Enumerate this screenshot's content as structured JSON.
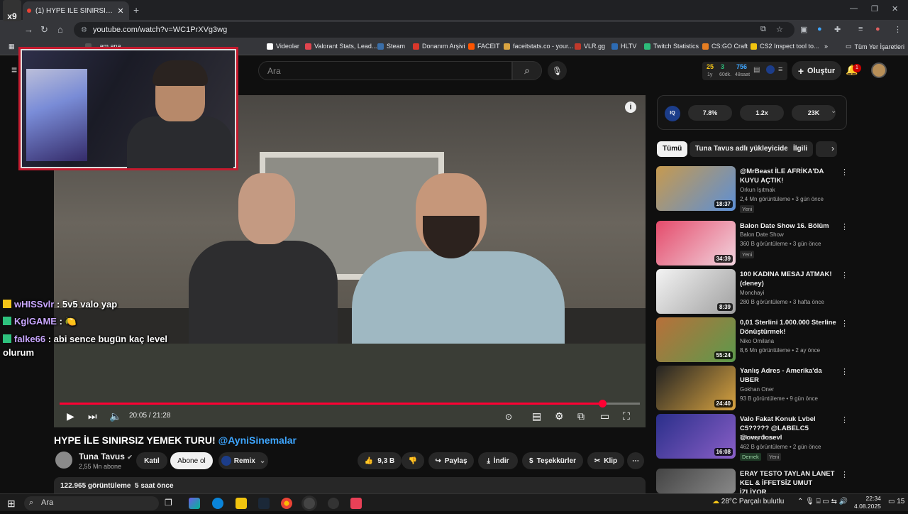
{
  "browser": {
    "tab_title": "(1) HYPE İLE SINIRSIZ YEMEK TU",
    "tab_close": "✕",
    "newtab": "+",
    "url": "youtube.com/watch?v=WC1PrXVg3wg",
    "bookmarks": [
      {
        "label": "...am ana...",
        "color": "#555555"
      },
      {
        "label": "Videolar",
        "color": "#ffffff"
      },
      {
        "label": "Valorant Stats, Lead...",
        "color": "#e0444e"
      },
      {
        "label": "Steam",
        "color": "#3a6ea8"
      },
      {
        "label": "Donanım Arşivi",
        "color": "#d9372b"
      },
      {
        "label": "FACEIT",
        "color": "#ff5500"
      },
      {
        "label": "faceitstats.co - your...",
        "color": "#d9a441"
      },
      {
        "label": "VLR.gg",
        "color": "#c0392b"
      },
      {
        "label": "HLTV",
        "color": "#2d6bb3"
      },
      {
        "label": "Twitch Statistics",
        "color": "#2dbb7a"
      },
      {
        "label": "CS:GO Craft",
        "color": "#e67e22"
      },
      {
        "label": "CS2 Inspect tool to...",
        "color": "#f1c40f"
      }
    ],
    "bookmarks_more": "»",
    "all_bookmarks": "Tüm Yer İşaretleri"
  },
  "youtube": {
    "search_placeholder": "Ara",
    "ext_stats": {
      "a": "25",
      "a_label": "1y",
      "b": "3",
      "b_label": "60dk.",
      "c": "756",
      "c_label": "48saat"
    },
    "create_label": "Oluştur",
    "notif_count": "1",
    "player": {
      "current_time": "20:05",
      "duration": "21:28",
      "progress": 0.935
    },
    "chat": [
      {
        "user": "wHISSvlr",
        "message": " : 5v5 valo yap",
        "mark_color": "#f5c518"
      },
      {
        "user": "KglGAME",
        "message": " : 🍋",
        "mark_color": "#2ec27e"
      },
      {
        "user": "falke66",
        "message": " : abi sence bugün kaç level",
        "message2": "olurum",
        "mark_color": "#2ec27e"
      }
    ],
    "video_title": "HYPE İLE SINIRSIZ YEMEK TURU!",
    "video_title_tag": "@AyniSinemalar",
    "channel_name": "Tuna Tavus",
    "channel_subs": "2,55 Mn abone",
    "join_label": "Katıl",
    "subscribe_label": "Abone ol",
    "remix_label": "Remix",
    "like_count": "9,3 B",
    "share_label": "Paylaş",
    "download_label": "İndir",
    "thanks_label": "Teşekkürler",
    "clip_label": "Klip",
    "views": "122.965 görüntüleme",
    "posted": "5 saat önce",
    "ext_panel": {
      "logo": "IQ",
      "chips": [
        "7.8%",
        "1.2x",
        "23K"
      ]
    },
    "filter_chips": [
      "Tümü",
      "Tuna Tavus adlı yükleyiciden",
      "İlgili"
    ],
    "recommendations": [
      {
        "title": "@MrBeast İLE AFRİKA'DA KUYU AÇTIK!",
        "channel": "Orkun Işıtmak",
        "meta": "2,4 Mn görüntüleme • 3 gün önce",
        "badge": "Yeni",
        "duration": "18:37",
        "thumb": [
          "#c79a4e",
          "#5c8fd6"
        ]
      },
      {
        "title": "Balon Date Show 16. Bölüm",
        "channel": "Balon Date Show",
        "meta": "360 B görüntüleme • 3 gün önce",
        "badge": "Yeni",
        "duration": "34:39",
        "thumb": [
          "#e44b6b",
          "#f2d4de"
        ]
      },
      {
        "title": "100 KADINA MESAJ ATMAK! (deney)",
        "channel": "Monchayi",
        "meta": "280 B görüntüleme • 3 hafta önce",
        "badge": "",
        "duration": "8:39",
        "thumb": [
          "#f3f3f3",
          "#a0a0a0"
        ]
      },
      {
        "title": "0,01 Sterlini 1.000.000 Sterline Dönüştürmek!",
        "channel": "Niko Omilana",
        "meta": "8,6 Mn görüntüleme • 2 ay önce",
        "badge": "",
        "duration": "55:24",
        "thumb": [
          "#b8703a",
          "#5c9a4c"
        ]
      },
      {
        "title": "Yanlış Adres - Amerika'da UBER",
        "channel": "Gokhan Oner",
        "meta": "93 B görüntüleme • 9 gün önce",
        "badge": "",
        "duration": "24:40",
        "thumb": [
          "#222222",
          "#d9a441"
        ]
      },
      {
        "title": "Valo Fakat Konuk Lvbel C5????? @LABELC5 @overdosevl",
        "channel": "Tolunay Ören",
        "meta": "462 B görüntüleme • 2 gün önce",
        "badge": "Demek",
        "badge2": "Yeni",
        "duration": "16:08",
        "thumb": [
          "#2a2f8a",
          "#8a5fc7"
        ]
      },
      {
        "title": "ERAY TESTO TAYLAN LANET KEL & İFFETSİZ UMUT İZLİYOR",
        "channel": "",
        "meta": "",
        "badge": "",
        "duration": "",
        "thumb": [
          "#444444",
          "#888888"
        ]
      }
    ]
  },
  "taskbar": {
    "search": "Ara",
    "weather": "28°C  Parçalı bulutlu",
    "time": "22:34",
    "date": "4.08.2025",
    "notif": "15"
  }
}
